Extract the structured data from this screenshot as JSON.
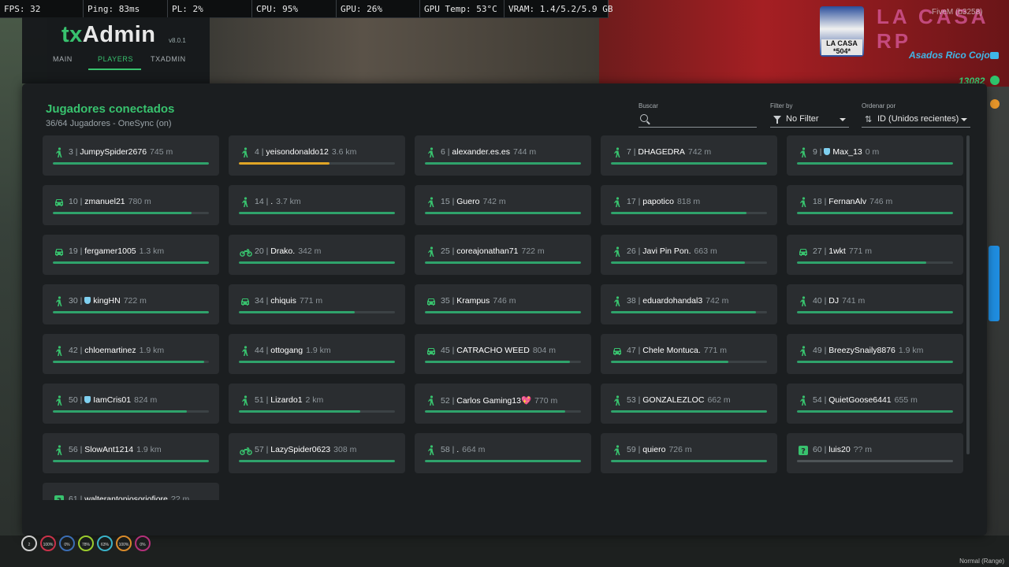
{
  "stats": [
    "FPS: 32",
    "Ping: 83ms",
    "PL: 2%",
    "CPU: 95%",
    "GPU: 26%",
    "GPU Temp: 53°C",
    "VRAM: 1.4/5.2/5.9 GB"
  ],
  "header": {
    "logo_tx": "tx",
    "logo_admin": "Admin",
    "version": "v8.0.1",
    "nav": [
      "MAIN",
      "PLAYERS",
      "TXADMIN"
    ]
  },
  "hud": {
    "server_logo_text": "LA CASA *504*",
    "fivem_tag": "FiveM (b3258)",
    "brand": "LA CASA RP",
    "player_name": "Asados Rico Cojo",
    "money": "13082"
  },
  "panel": {
    "title": "Jugadores conectados",
    "subtitle": "36/64 Jugadores - OneSync (on)",
    "search_label": "Buscar",
    "search_value": "",
    "filter_label": "Filter by",
    "filter_value": "No Filter",
    "sort_label": "Ordenar por",
    "sort_value": "ID (Unidos recientes)"
  },
  "colors": {
    "accent": "#38c26e",
    "health_full": "#2fa36b",
    "health_low": "#e0a526",
    "unknown": "#4e5457"
  },
  "players": [
    {
      "id": "3",
      "name": "JumpySpider2676",
      "dist": "745 m",
      "icon": "walking-icon",
      "health": 1.0
    },
    {
      "id": "4",
      "name": "yeisondonaldo12",
      "dist": "3.6 km",
      "icon": "walking-icon",
      "health": 0.58,
      "low": true
    },
    {
      "id": "6",
      "name": "alexander.es.es",
      "dist": "744 m",
      "icon": "walking-icon",
      "health": 1.0
    },
    {
      "id": "7",
      "name": "DHAGEDRA",
      "dist": "742 m",
      "icon": "walking-icon",
      "health": 1.0
    },
    {
      "id": "9",
      "name": "Max_13",
      "dist": "0 m",
      "icon": "walking-icon",
      "health": 1.0,
      "shield": true
    },
    {
      "id": "10",
      "name": "zmanuel21",
      "dist": "780 m",
      "icon": "car-icon",
      "health": 0.89
    },
    {
      "id": "14",
      "name": ".",
      "dist": "3.7 km",
      "icon": "walking-icon",
      "health": 1.0
    },
    {
      "id": "15",
      "name": "Guero",
      "dist": "742 m",
      "icon": "walking-icon",
      "health": 1.0
    },
    {
      "id": "17",
      "name": "papotico",
      "dist": "818 m",
      "icon": "walking-icon",
      "health": 0.87
    },
    {
      "id": "18",
      "name": "FernanAlv",
      "dist": "746 m",
      "icon": "walking-icon",
      "health": 1.0
    },
    {
      "id": "19",
      "name": "fergamer1005",
      "dist": "1.3 km",
      "icon": "car-icon",
      "health": 1.0
    },
    {
      "id": "20",
      "name": "Drako.",
      "dist": "342 m",
      "icon": "motorcycle-icon",
      "health": 1.0
    },
    {
      "id": "25",
      "name": "coreajonathan71",
      "dist": "722 m",
      "icon": "walking-icon",
      "health": 1.0
    },
    {
      "id": "26",
      "name": "Javi Pin Pon.",
      "dist": "663 m",
      "icon": "walking-icon",
      "health": 0.86
    },
    {
      "id": "27",
      "name": "1wkt",
      "dist": "771 m",
      "icon": "car-icon",
      "health": 0.83
    },
    {
      "id": "30",
      "name": "kingHN",
      "dist": "722 m",
      "icon": "walking-icon",
      "health": 1.0,
      "shield": true
    },
    {
      "id": "34",
      "name": "chiquis",
      "dist": "771 m",
      "icon": "car-icon",
      "health": 0.74
    },
    {
      "id": "35",
      "name": "Krampus",
      "dist": "746 m",
      "icon": "car-icon",
      "health": 1.0
    },
    {
      "id": "38",
      "name": "eduardohandal3",
      "dist": "742 m",
      "icon": "walking-icon",
      "health": 0.93
    },
    {
      "id": "40",
      "name": "DJ",
      "dist": "741 m",
      "icon": "walking-icon",
      "health": 1.0
    },
    {
      "id": "42",
      "name": "chloemartinez",
      "dist": "1.9 km",
      "icon": "walking-icon",
      "health": 0.97
    },
    {
      "id": "44",
      "name": "ottogang",
      "dist": "1.9 km",
      "icon": "walking-icon",
      "health": 1.0
    },
    {
      "id": "45",
      "name": "CATRACHO WEED",
      "dist": "804 m",
      "icon": "car-icon",
      "health": 0.93
    },
    {
      "id": "47",
      "name": "Chele Montuca.",
      "dist": "771 m",
      "icon": "car-icon",
      "health": 0.75
    },
    {
      "id": "49",
      "name": "BreezySnaily8876",
      "dist": "1.9 km",
      "icon": "walking-icon",
      "health": 1.0
    },
    {
      "id": "50",
      "name": "IamCris01",
      "dist": "824 m",
      "icon": "walking-icon",
      "health": 0.86,
      "shield": true
    },
    {
      "id": "51",
      "name": "Lizardo1",
      "dist": "2 km",
      "icon": "walking-icon",
      "health": 0.78
    },
    {
      "id": "52",
      "name": "Carlos Gaming13💖",
      "dist": "770 m",
      "icon": "walking-icon",
      "health": 0.9
    },
    {
      "id": "53",
      "name": "GONZALEZLOC",
      "dist": "662 m",
      "icon": "walking-icon",
      "health": 1.0
    },
    {
      "id": "54",
      "name": "QuietGoose6441",
      "dist": "655 m",
      "icon": "walking-icon",
      "health": 1.0
    },
    {
      "id": "56",
      "name": "SlowAnt1214",
      "dist": "1.9 km",
      "icon": "walking-icon",
      "health": 1.0
    },
    {
      "id": "57",
      "name": "LazySpider0623",
      "dist": "308 m",
      "icon": "motorcycle-icon",
      "health": 1.0
    },
    {
      "id": "58",
      "name": ".",
      "dist": "664 m",
      "icon": "walking-icon",
      "health": 1.0
    },
    {
      "id": "59",
      "name": "quiero",
      "dist": "726 m",
      "icon": "walking-icon",
      "health": 1.0
    },
    {
      "id": "60",
      "name": "luis20",
      "dist": "?? m",
      "icon": "question-icon",
      "health": 0.0,
      "unknown": true
    },
    {
      "id": "61",
      "name": "walterantoniosoriofiore",
      "dist": "?? m",
      "icon": "question-icon",
      "health": 0.0,
      "unknown": true,
      "partial": true
    }
  ],
  "status_circles": [
    "2",
    "100%",
    "0%",
    "78%",
    "63%",
    "100%",
    "0%"
  ],
  "bottom_right": "Normal (Range)"
}
